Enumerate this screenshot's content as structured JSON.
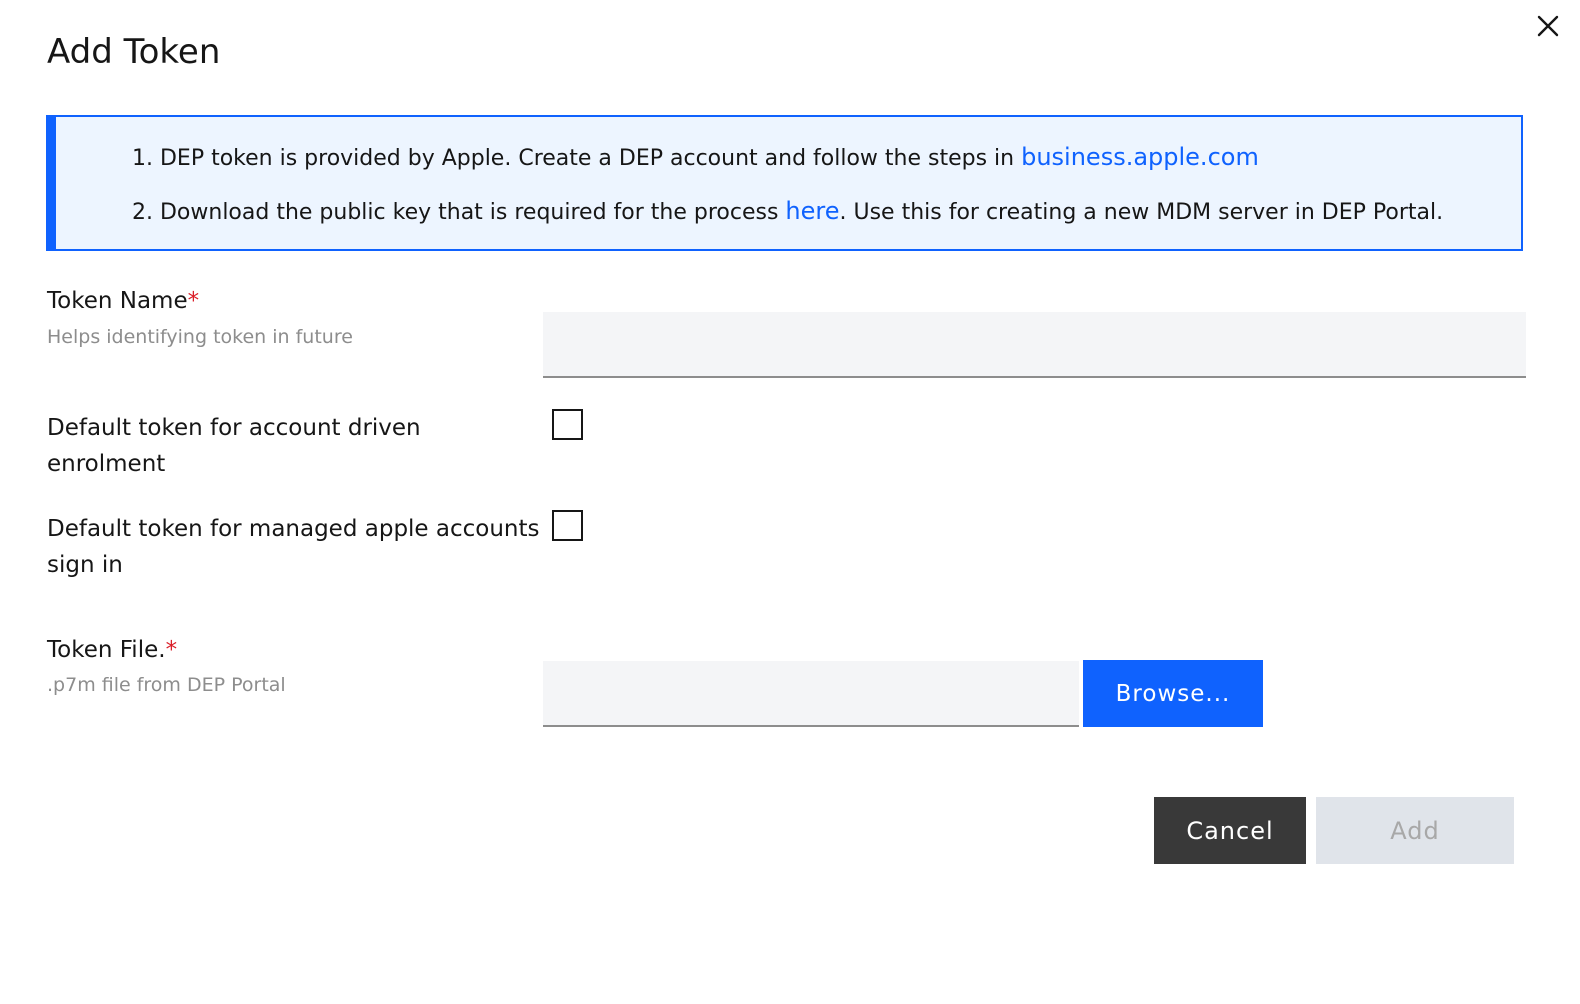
{
  "dialog": {
    "title": "Add Token",
    "close_icon": "close-icon"
  },
  "info": {
    "line1_text": "1. DEP token is provided by Apple. Create a DEP account and follow the steps in ",
    "line1_link": "business.apple.com",
    "line2_prefix": "2. Download the public key that is required for the process ",
    "line2_link": "here",
    "line2_suffix": ". Use this for creating a new MDM server in DEP Portal."
  },
  "form": {
    "token_name": {
      "label": "Token Name",
      "required_mark": "*",
      "help": "Helps identifying token in future",
      "value": ""
    },
    "default_account_driven": {
      "label": "Default token for account driven enrolment",
      "checked": false
    },
    "default_managed_apple": {
      "label": "Default token for managed apple accounts sign in",
      "checked": false
    },
    "token_file": {
      "label": "Token File.",
      "required_mark": "*",
      "help": ".p7m file from DEP Portal",
      "browse_label": "Browse..."
    }
  },
  "actions": {
    "cancel_label": "Cancel",
    "add_label": "Add"
  },
  "colors": {
    "primary": "#0f62fe",
    "info_bg": "#edf5ff",
    "required": "#da1e28",
    "cancel_bg": "#393939",
    "disabled_bg": "#e0e4ea"
  }
}
